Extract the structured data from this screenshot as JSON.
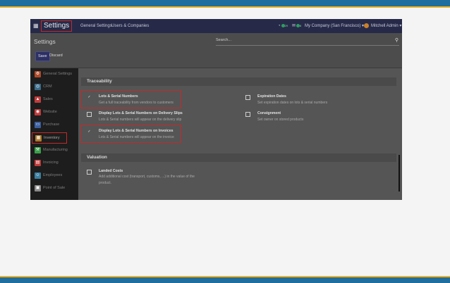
{
  "navbar": {
    "title": "Settings",
    "menu": [
      "General Settings",
      "Users & Companies"
    ],
    "activity_count": "29",
    "messages_count": "8",
    "company": "My Company (San Francisco)",
    "user": "Mitchell Admin"
  },
  "control_panel": {
    "title": "Settings",
    "search_placeholder": "Search...",
    "save_label": "Save",
    "discard_label": "Discard"
  },
  "sidebar": {
    "items": [
      {
        "label": "General Settings",
        "color": "#b04a2a",
        "glyph": "⚙"
      },
      {
        "label": "CRM",
        "color": "#3c6b8a",
        "glyph": "◎"
      },
      {
        "label": "Sales",
        "color": "#c23b3b",
        "glyph": "▲"
      },
      {
        "label": "Website",
        "color": "#c23b3b",
        "glyph": "◉"
      },
      {
        "label": "Purchase",
        "color": "#3b5fa0",
        "glyph": "▭"
      },
      {
        "label": "Inventory",
        "color": "#b07a2a",
        "glyph": "▦"
      },
      {
        "label": "Manufacturing",
        "color": "#3aa04a",
        "glyph": "⚒"
      },
      {
        "label": "Invoicing",
        "color": "#c23b3b",
        "glyph": "▤"
      },
      {
        "label": "Employees",
        "color": "#3b7fa0",
        "glyph": "☺"
      },
      {
        "label": "Point of Sale",
        "color": "#8a8a8a",
        "glyph": "▣"
      }
    ]
  },
  "sections": {
    "traceability": {
      "title": "Traceability",
      "settings": [
        {
          "title": "Lots & Serial Numbers",
          "desc": "Get a full traceability from vendors to customers",
          "checked": "✓"
        },
        {
          "title": "Expiration Dates",
          "desc": "Set expiration dates on lots & serial numbers",
          "checked": ""
        },
        {
          "title": "Display Lots & Serial Numbers on Delivery Slips",
          "desc": "Lots & Serial numbers will appear on the delivery slip",
          "checked": ""
        },
        {
          "title": "Consignment",
          "desc": "Set owner on stored products",
          "checked": ""
        },
        {
          "title": "Display Lots & Serial Numbers on Invoices",
          "desc": "Lots & Serial numbers will appear on the invoice",
          "checked": "✓"
        }
      ]
    },
    "valuation": {
      "title": "Valuation",
      "settings": [
        {
          "title": "Landed Costs",
          "desc": "Add additional cost (transport, customs, ...) in the value of the product.",
          "checked": ""
        }
      ]
    }
  },
  "colors": {
    "highlight": "#c22a2a",
    "navbar": "#262a48",
    "save": "#2d3063"
  }
}
